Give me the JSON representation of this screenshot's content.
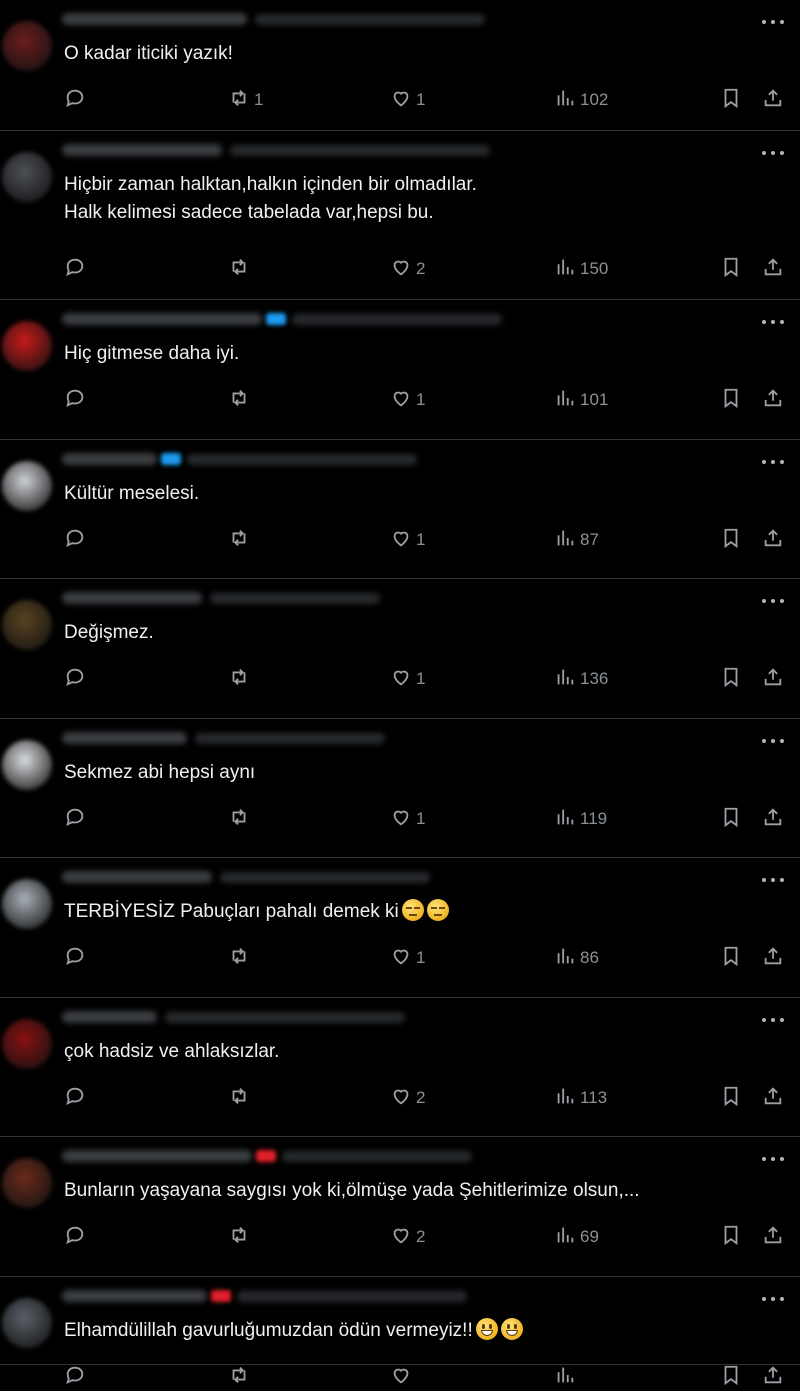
{
  "tweets": [
    {
      "text": "O kadar iticiki yazık!",
      "retweets": "1",
      "likes": "1",
      "views": "102",
      "avatar_color": "#6b1d1d"
    },
    {
      "text": "Hiçbir zaman halktan,halkın içinden bir olmadılar.\nHalk kelimesi sadece tabelada var,hepsi bu.",
      "retweets": "",
      "likes": "2",
      "views": "150",
      "avatar_color": "#4d5056"
    },
    {
      "text": "Hiç gitmese daha iyi.",
      "retweets": "",
      "likes": "1",
      "views": "101",
      "avatar_color": "#c81a1a"
    },
    {
      "text": "Kültür meselesi.",
      "retweets": "",
      "likes": "1",
      "views": "87",
      "avatar_color": "#cfd2d6"
    },
    {
      "text": "Değişmez.",
      "retweets": "",
      "likes": "1",
      "views": "136",
      "avatar_color": "#5a4320"
    },
    {
      "text": "Sekmez abi hepsi aynı",
      "retweets": "",
      "likes": "1",
      "views": "119",
      "avatar_color": "#dadde0"
    },
    {
      "text": "TERBİYESİZ Pabuçları pahalı demek ki",
      "emojis": [
        "neutral",
        "neutral"
      ],
      "retweets": "",
      "likes": "1",
      "views": "86",
      "avatar_color": "#a9b0b8"
    },
    {
      "text": "çok hadsiz ve ahlaksızlar.",
      "retweets": "",
      "likes": "2",
      "views": "113",
      "avatar_color": "#8a1111"
    },
    {
      "text": "Bunların yaşayana saygısı yok ki,ölmüşe yada Şehitlerimize olsun,...",
      "retweets": "",
      "likes": "2",
      "views": "69",
      "avatar_color": "#6a2a1a"
    },
    {
      "text": "Elhamdülillah gavurluğumuzdan ödün vermeyiz!!",
      "emojis": [
        "grin",
        "grin"
      ],
      "retweets": "",
      "likes": "",
      "views": "",
      "avatar_color": "#5a6068"
    }
  ],
  "icons": {
    "reply": "reply-icon",
    "retweet": "retweet-icon",
    "like": "heart-icon",
    "views": "views-icon",
    "bookmark": "bookmark-icon",
    "share": "share-icon",
    "more": "more-icon"
  }
}
